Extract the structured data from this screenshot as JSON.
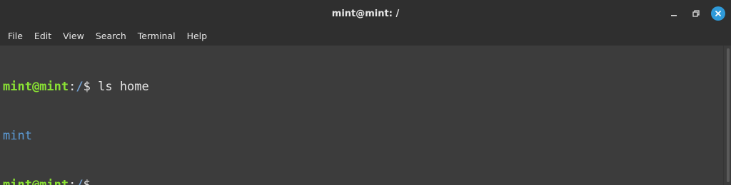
{
  "window": {
    "title": "mint@mint: /"
  },
  "controls": {
    "minimize_icon": "minimize-icon",
    "maximize_icon": "restore-icon",
    "close_icon": "close-icon",
    "close_color": "#2f9ad9"
  },
  "menu": {
    "items": [
      "File",
      "Edit",
      "View",
      "Search",
      "Terminal",
      "Help"
    ]
  },
  "terminal": {
    "lines": [
      {
        "user": "mint@mint",
        "sep": ":",
        "path": "/",
        "prompt": "$ ",
        "command": "ls home"
      },
      {
        "output": "mint"
      },
      {
        "user": "mint@mint",
        "sep": ":",
        "path": "/",
        "prompt": "$",
        "command": ""
      }
    ],
    "colors": {
      "user": "#8ae234",
      "path": "#729fcf",
      "directory": "#5c9bd6",
      "text": "#e6e6e6",
      "background": "#3c3c3c"
    }
  }
}
